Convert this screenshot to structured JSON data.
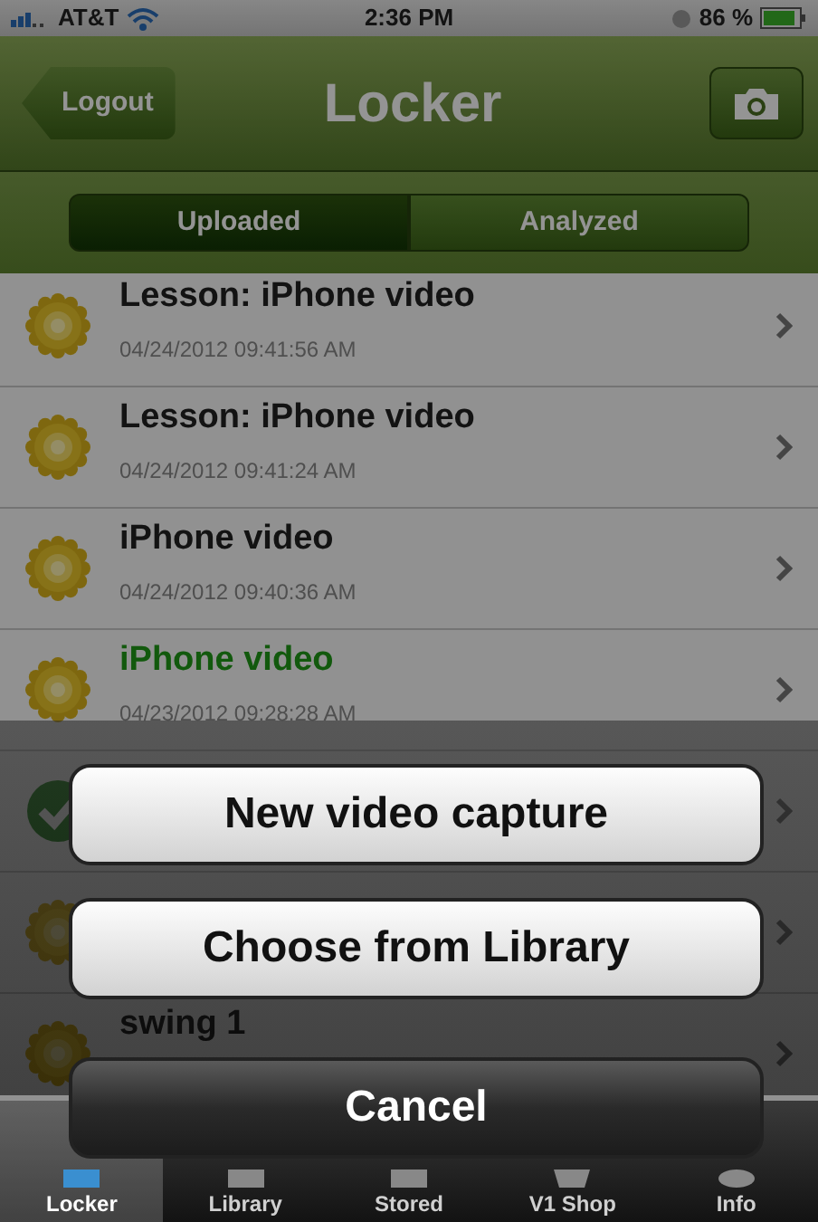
{
  "status_bar": {
    "carrier": "AT&T",
    "time": "2:36 PM",
    "battery": "86 %"
  },
  "nav_bar": {
    "back_button": "Logout",
    "title": "Locker"
  },
  "segments": [
    {
      "label": "Uploaded",
      "selected": true
    },
    {
      "label": "Analyzed",
      "selected": false
    }
  ],
  "rows": [
    {
      "kind": "sun",
      "title": "Lesson: iPhone video",
      "date": "04/24/2012 09:41:56 AM",
      "highlighted": false
    },
    {
      "kind": "sun",
      "title": "Lesson: iPhone video",
      "date": "04/24/2012 09:41:24 AM",
      "highlighted": false
    },
    {
      "kind": "sun",
      "title": "iPhone video",
      "date": "04/24/2012 09:40:36 AM",
      "highlighted": false
    },
    {
      "kind": "sun",
      "title": "iPhone video",
      "date": "04/23/2012 09:28:28 AM",
      "highlighted": true
    },
    {
      "kind": "check"
    },
    {
      "kind": "sun"
    },
    {
      "kind": "sun",
      "title": "swing 1",
      "highlighted": false
    }
  ],
  "action_sheet": {
    "buttons": [
      {
        "label": "New video capture",
        "kind": "default"
      },
      {
        "label": "Choose from Library",
        "kind": "default"
      },
      {
        "label": "Cancel",
        "kind": "cancel"
      }
    ]
  },
  "tab_bar": [
    {
      "label": "Locker",
      "selected": true
    },
    {
      "label": "Library",
      "selected": false
    },
    {
      "label": "Stored",
      "selected": false
    },
    {
      "label": "V1 Shop",
      "selected": false
    },
    {
      "label": "Info",
      "selected": false
    }
  ]
}
